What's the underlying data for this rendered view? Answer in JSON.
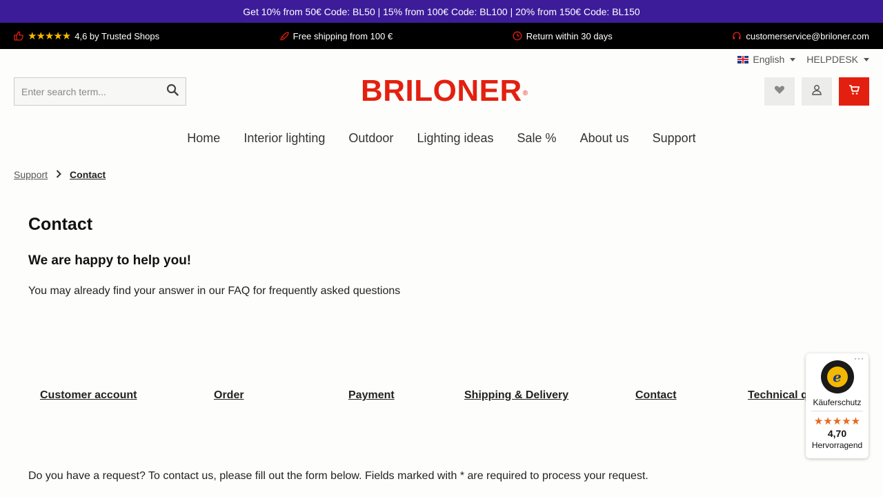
{
  "promo": {
    "text": "Get 10% from 50€ Code: BL50 | 15% from 100€ Code: BL100 | 20% from 150€ Code: BL150"
  },
  "usp": {
    "rating_stars": "★★★★★",
    "rating_text": "4,6 by Trusted Shops",
    "shipping": "Free shipping from 100 €",
    "returns": "Return within 30 days",
    "email": "customerservice@briloner.com"
  },
  "topbar": {
    "language": "English",
    "helpdesk": "HELPDESK"
  },
  "search": {
    "placeholder": "Enter search term..."
  },
  "brand": {
    "name": "BRILONER",
    "registered": "®",
    "color": "#e3200f"
  },
  "nav": [
    "Home",
    "Interior lighting",
    "Outdoor",
    "Lighting ideas",
    "Sale %",
    "About us",
    "Support"
  ],
  "breadcrumb": {
    "parent": "Support",
    "current": "Contact"
  },
  "content": {
    "title": "Contact",
    "subtitle": "We are happy to help you!",
    "lead": "You may already find your answer in our FAQ for frequently asked questions",
    "links": [
      "Customer account",
      "Order",
      "Payment",
      "Shipping & Delivery",
      "Contact",
      "Technical questions"
    ],
    "note": "Do you have a request? To contact us, please fill out the form below. Fields marked with * are required to process your request."
  },
  "trustbadge": {
    "dots": "···",
    "seal_letter": "e",
    "label": "Käuferschutz",
    "stars": "★★★★★",
    "score": "4,70",
    "verdict": "Hervorragend"
  },
  "colors": {
    "promo_bg": "#3d1c9a",
    "accent": "#e3200f"
  }
}
